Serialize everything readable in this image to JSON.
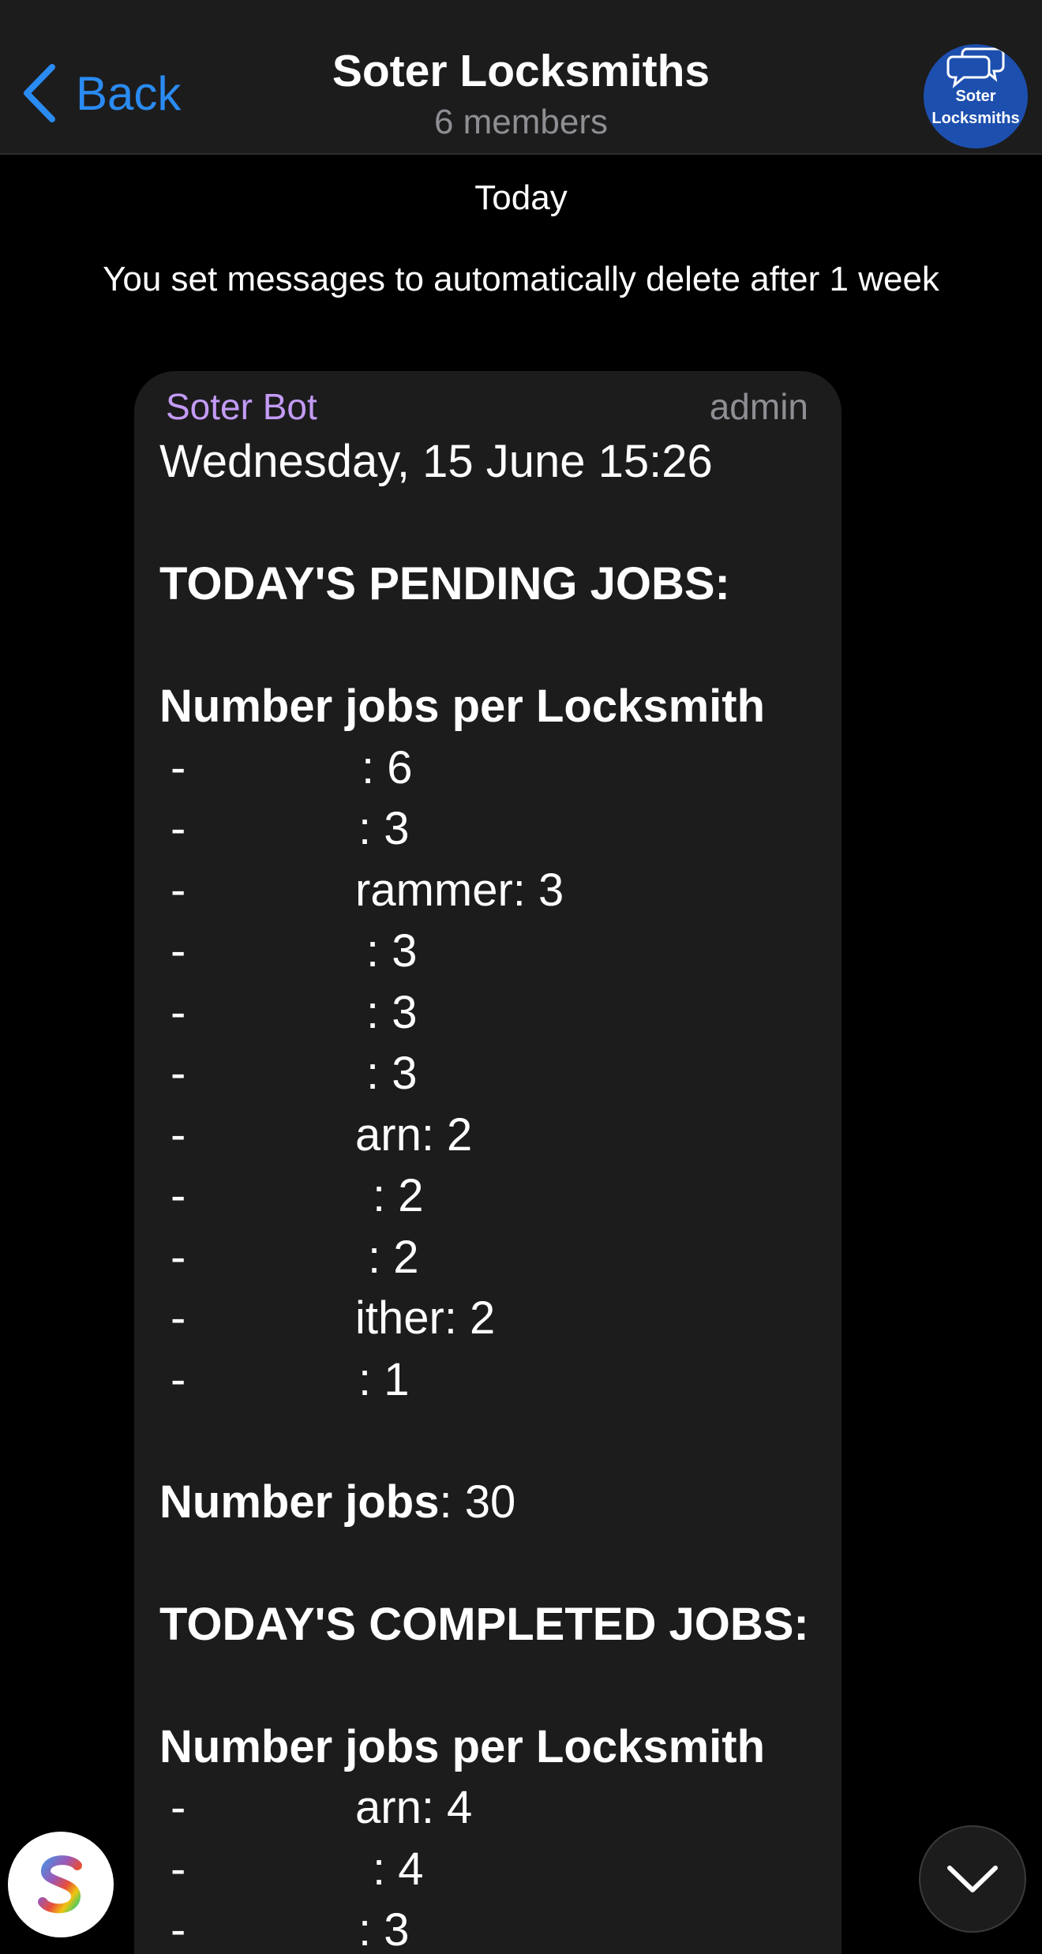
{
  "header": {
    "back_label": "Back",
    "title": "Soter Locksmiths",
    "subtitle": "6 members",
    "avatar_line1": "Soter",
    "avatar_line2": "Locksmiths"
  },
  "chat": {
    "date_separator": "Today",
    "service_message": "You set messages to automatically delete after 1 week"
  },
  "message": {
    "sender": "Soter Bot",
    "role": "admin",
    "datetime": "Wednesday, 15 June 15:26",
    "pending_heading": "TODAY'S PENDING JOBS:",
    "per_locksmith_heading": "Number jobs per Locksmith",
    "pending_items": [
      ": 6",
      ": 3",
      "rammer: 3",
      ": 3",
      ": 3",
      ": 3",
      "arn: 2",
      ": 2",
      ": 2",
      "ither: 2",
      ": 1"
    ],
    "total_label": "Number jobs",
    "total_value": ": 30",
    "completed_heading": "TODAY'S COMPLETED JOBS:",
    "completed_per_locksmith_heading": "Number jobs per Locksmith",
    "completed_items": [
      "arn: 4",
      ": 4",
      ": 3"
    ],
    "dash": "-"
  },
  "colors": {
    "accent": "#2a8bf2",
    "sender": "#c39bf5",
    "bubble": "#1c1c1d",
    "header": "#1c1c1d",
    "avatar": "#1d4fae"
  },
  "icons": {
    "back": "chevron-left-icon",
    "avatar": "chat-bubbles-icon",
    "app": "s-logo-icon",
    "scroll_down": "chevron-down-icon"
  }
}
